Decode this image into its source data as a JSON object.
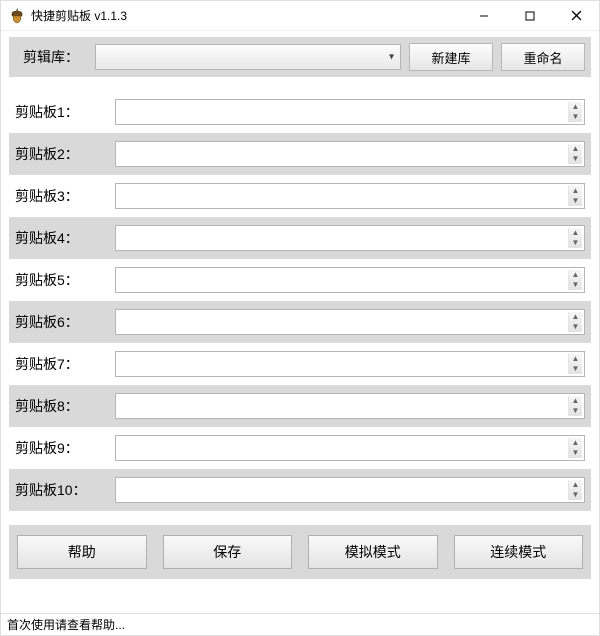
{
  "window": {
    "title": "快捷剪贴板 v1.1.3"
  },
  "top": {
    "library_label": "剪辑库：",
    "library_value": "",
    "new_library_btn": "新建库",
    "rename_btn": "重命名"
  },
  "clips": [
    {
      "label": "剪贴板1：",
      "value": ""
    },
    {
      "label": "剪贴板2：",
      "value": ""
    },
    {
      "label": "剪贴板3：",
      "value": ""
    },
    {
      "label": "剪贴板4：",
      "value": ""
    },
    {
      "label": "剪贴板5：",
      "value": ""
    },
    {
      "label": "剪贴板6：",
      "value": ""
    },
    {
      "label": "剪贴板7：",
      "value": ""
    },
    {
      "label": "剪贴板8：",
      "value": ""
    },
    {
      "label": "剪贴板9：",
      "value": ""
    },
    {
      "label": "剪贴板10：",
      "value": ""
    }
  ],
  "bottom": {
    "help_btn": "帮助",
    "save_btn": "保存",
    "sim_mode_btn": "模拟模式",
    "cont_mode_btn": "连续模式"
  },
  "status": {
    "text": "首次使用请查看帮助..."
  }
}
